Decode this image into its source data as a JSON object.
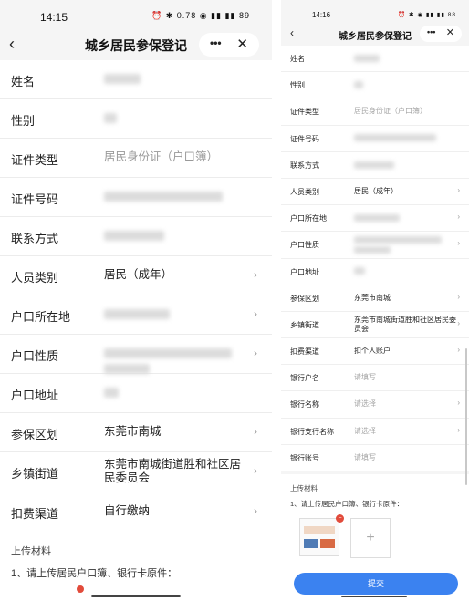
{
  "left": {
    "status": {
      "time": "14:15",
      "icons": "⏰ ✱ 0.78 ◉ ▮▮ ▮▮ 89"
    },
    "title": "城乡居民参保登记",
    "rows": [
      {
        "label": "姓名"
      },
      {
        "label": "性别"
      },
      {
        "label": "证件类型",
        "value": "居民身份证（户口簿）"
      },
      {
        "label": "证件号码"
      },
      {
        "label": "联系方式"
      },
      {
        "label": "人员类别",
        "value": "居民（成年）"
      },
      {
        "label": "户口所在地"
      },
      {
        "label": "户口性质"
      },
      {
        "label": "户口地址"
      },
      {
        "label": "参保区划",
        "value": "东莞市南城"
      },
      {
        "label": "乡镇街道",
        "value": "东莞市南城街道胜和社区居民委员会"
      },
      {
        "label": "扣费渠道",
        "value": "自行缴纳"
      }
    ],
    "upload_title": "上传材料",
    "upload_note": "1、请上传居民户口簿、银行卡原件："
  },
  "right": {
    "status": {
      "time": "14:16",
      "icons": "⏰ ✱ ◉ ▮▮ ▮▮ 88"
    },
    "title": "城乡居民参保登记",
    "rows": [
      {
        "label": "姓名"
      },
      {
        "label": "性别"
      },
      {
        "label": "证件类型",
        "value": "居民身份证（户口簿）"
      },
      {
        "label": "证件号码"
      },
      {
        "label": "联系方式"
      },
      {
        "label": "人员类别",
        "value": "居民（成年）"
      },
      {
        "label": "户口所在地"
      },
      {
        "label": "户口性质"
      },
      {
        "label": "户口地址"
      },
      {
        "label": "参保区划",
        "value": "东莞市南城"
      },
      {
        "label": "乡镇街道",
        "value": "东莞市南城街道胜和社区居民委员会"
      },
      {
        "label": "扣费渠道",
        "value": "扣个人账户"
      },
      {
        "label": "银行户名",
        "placeholder": "请填写"
      },
      {
        "label": "银行名称",
        "placeholder": "请选择"
      },
      {
        "label": "银行支行名称",
        "placeholder": "请选择"
      },
      {
        "label": "银行账号",
        "placeholder": "请填写"
      }
    ],
    "upload_title": "上传材料",
    "upload_note": "1、请上传居民户口簿、银行卡原件：",
    "submit_label": "提交"
  },
  "icons": {
    "back": "back-arrow-icon",
    "more": "more-dots-icon",
    "close": "close-icon",
    "chevron": "chevron-right-icon",
    "add": "plus-icon"
  },
  "colors": {
    "accent": "#3b82f0",
    "delete": "#e24b3b"
  }
}
